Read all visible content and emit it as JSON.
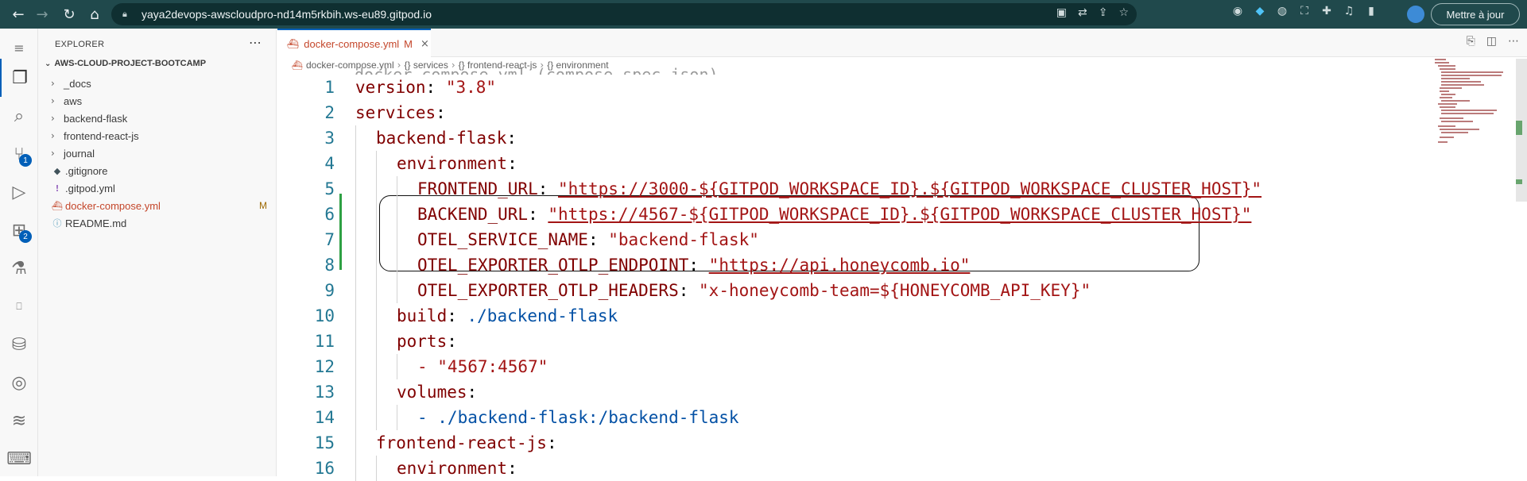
{
  "browser": {
    "url": "yaya2devops-awscloudpro-nd14m5rkbih.ws-eu89.gitpod.io",
    "update_label": "Mettre à jour"
  },
  "sidebar": {
    "title": "EXPLORER",
    "project": "AWS-CLOUD-PROJECT-BOOTCAMP",
    "items": [
      {
        "label": "_docs",
        "type": "folder"
      },
      {
        "label": "aws",
        "type": "folder"
      },
      {
        "label": "backend-flask",
        "type": "folder"
      },
      {
        "label": "frontend-react-js",
        "type": "folder"
      },
      {
        "label": "journal",
        "type": "folder"
      },
      {
        "label": ".gitignore",
        "type": "file",
        "icon": "git-icon"
      },
      {
        "label": ".gitpod.yml",
        "type": "file",
        "icon": "yaml-icon"
      },
      {
        "label": "docker-compose.yml",
        "type": "file",
        "icon": "docker-icon",
        "status": "M"
      },
      {
        "label": "README.md",
        "type": "file",
        "icon": "info-icon"
      }
    ]
  },
  "activity_badges": {
    "source_control": "1",
    "extensions": "2"
  },
  "editor": {
    "tab": {
      "name": "docker-compose.yml",
      "status": "M"
    },
    "breadcrumb": [
      "docker-compose.yml",
      "{} services",
      "{} frontend-react-js",
      "{} environment"
    ],
    "schema_hint": "docker-compose.yml (compose-spec.json)",
    "lines": [
      {
        "n": "1",
        "key": "version",
        "value": "\"3.8\"",
        "indent": 0
      },
      {
        "n": "2",
        "key": "services",
        "value": "",
        "indent": 0
      },
      {
        "n": "3",
        "key": "backend-flask",
        "value": "",
        "indent": 1
      },
      {
        "n": "4",
        "key": "environment",
        "value": "",
        "indent": 2
      },
      {
        "n": "5",
        "key": "FRONTEND_URL",
        "value": "\"https://3000-${GITPOD_WORKSPACE_ID}.${GITPOD_WORKSPACE_CLUSTER_HOST}\"",
        "indent": 3
      },
      {
        "n": "6",
        "key": "BACKEND_URL",
        "value": "\"https://4567-${GITPOD_WORKSPACE_ID}.${GITPOD_WORKSPACE_CLUSTER_HOST}\"",
        "indent": 3
      },
      {
        "n": "7",
        "key": "OTEL_SERVICE_NAME",
        "value": "\"backend-flask\"",
        "indent": 3
      },
      {
        "n": "8",
        "key": "OTEL_EXPORTER_OTLP_ENDPOINT",
        "value": "\"https://api.honeycomb.io\"",
        "indent": 3
      },
      {
        "n": "9",
        "key": "OTEL_EXPORTER_OTLP_HEADERS",
        "value": "\"x-honeycomb-team=${HONEYCOMB_API_KEY}\"",
        "indent": 3
      },
      {
        "n": "10",
        "key": "build",
        "value": "./backend-flask",
        "indent": 2
      },
      {
        "n": "11",
        "key": "ports",
        "value": "",
        "indent": 2
      },
      {
        "n": "12",
        "key": "",
        "value": "- \"4567:4567\"",
        "indent": 3
      },
      {
        "n": "13",
        "key": "volumes",
        "value": "",
        "indent": 2
      },
      {
        "n": "14",
        "key": "",
        "value": "- ./backend-flask:/backend-flask",
        "indent": 3
      },
      {
        "n": "15",
        "key": "frontend-react-js",
        "value": "",
        "indent": 1
      },
      {
        "n": "16",
        "key": "environment",
        "value": "",
        "indent": 2
      }
    ]
  },
  "colors": {
    "accent": "#005fb8",
    "browser_bar": "#20494c",
    "yaml_key": "#800000",
    "yaml_string": "#a31515",
    "modified": "#c4462a"
  }
}
